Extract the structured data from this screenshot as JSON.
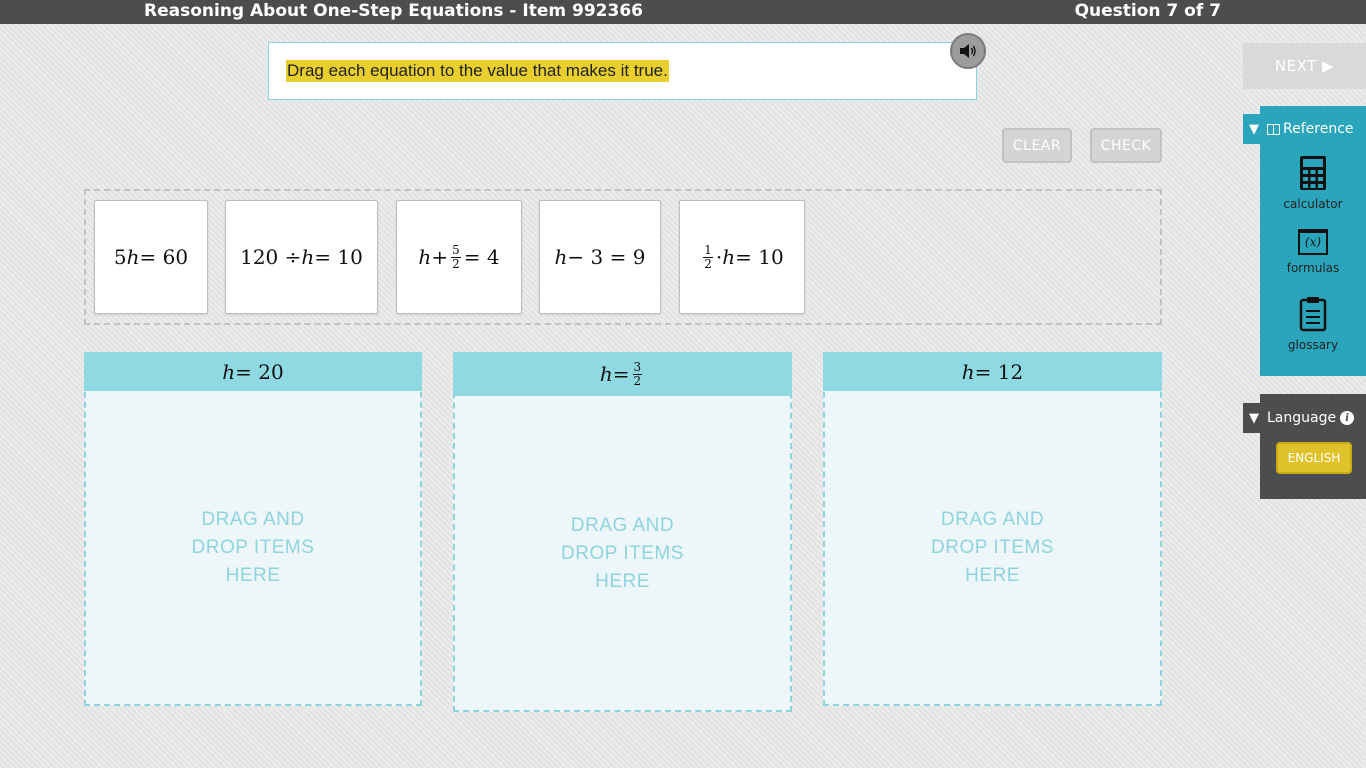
{
  "header": {
    "title": "Reasoning About One-Step Equations - Item 992366",
    "question_count": "Question 7 of 7"
  },
  "prompt": {
    "text": "Drag each equation to the value that makes it true."
  },
  "actions": {
    "clear_label": "CLEAR",
    "check_label": "CHECK",
    "next_label": "NEXT ▶"
  },
  "cards": [
    {
      "pre": "5",
      "var": "h",
      "post": " = 60"
    },
    {
      "pre": "120 ÷ ",
      "var": "h",
      "post": " = 10"
    },
    {
      "var": "h",
      "mid": " + ",
      "num": "5",
      "den": "2",
      "post": " = 4"
    },
    {
      "var": "h",
      "post": " − 3 = 9"
    },
    {
      "num": "1",
      "den": "2",
      "mid": "· ",
      "var": "h",
      "post": " = 10"
    }
  ],
  "bins": [
    {
      "var": "h",
      "eq": " = 20",
      "drop_text_1": "DRAG AND",
      "drop_text_2": "DROP ITEMS",
      "drop_text_3": "HERE"
    },
    {
      "var": "h",
      "eq": " = ",
      "num": "3",
      "den": "2",
      "drop_text_1": "DRAG AND",
      "drop_text_2": "DROP ITEMS",
      "drop_text_3": "HERE"
    },
    {
      "var": "h",
      "eq": " = 12",
      "drop_text_1": "DRAG AND",
      "drop_text_2": "DROP ITEMS",
      "drop_text_3": "HERE"
    }
  ],
  "sidebar": {
    "reference_label": "Reference",
    "tools": [
      {
        "label": "calculator",
        "icon": "calculator-icon"
      },
      {
        "label": "formulas",
        "icon": "formulas-icon"
      },
      {
        "label": "glossary",
        "icon": "clipboard-icon"
      }
    ],
    "language_label": "Language",
    "language_value": "ENGLISH",
    "formulas_glyph": "(x)"
  },
  "colors": {
    "accent_teal": "#2aa5bb",
    "highlight_yellow": "#e8cf2e",
    "bin_header": "#8fd9e3"
  }
}
